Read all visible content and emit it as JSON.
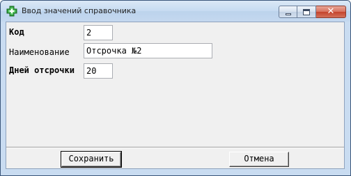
{
  "window": {
    "title": "Ввод значений справочника",
    "icon": "green-cross-icon",
    "close_glyph": "✕"
  },
  "form": {
    "code": {
      "label": "Код",
      "value": "2"
    },
    "name": {
      "label": "Наименование",
      "value": "Отсрочка №2"
    },
    "days": {
      "label": "Дней отсрочки",
      "value": "20"
    }
  },
  "buttons": {
    "save_label": "Сохранить",
    "cancel_label": "Отмена"
  },
  "colors": {
    "title_bar": "#c6dbf1",
    "client_bg": "#f0f0f0",
    "close_button": "#c4432c",
    "icon_green": "#2e9e3a"
  }
}
